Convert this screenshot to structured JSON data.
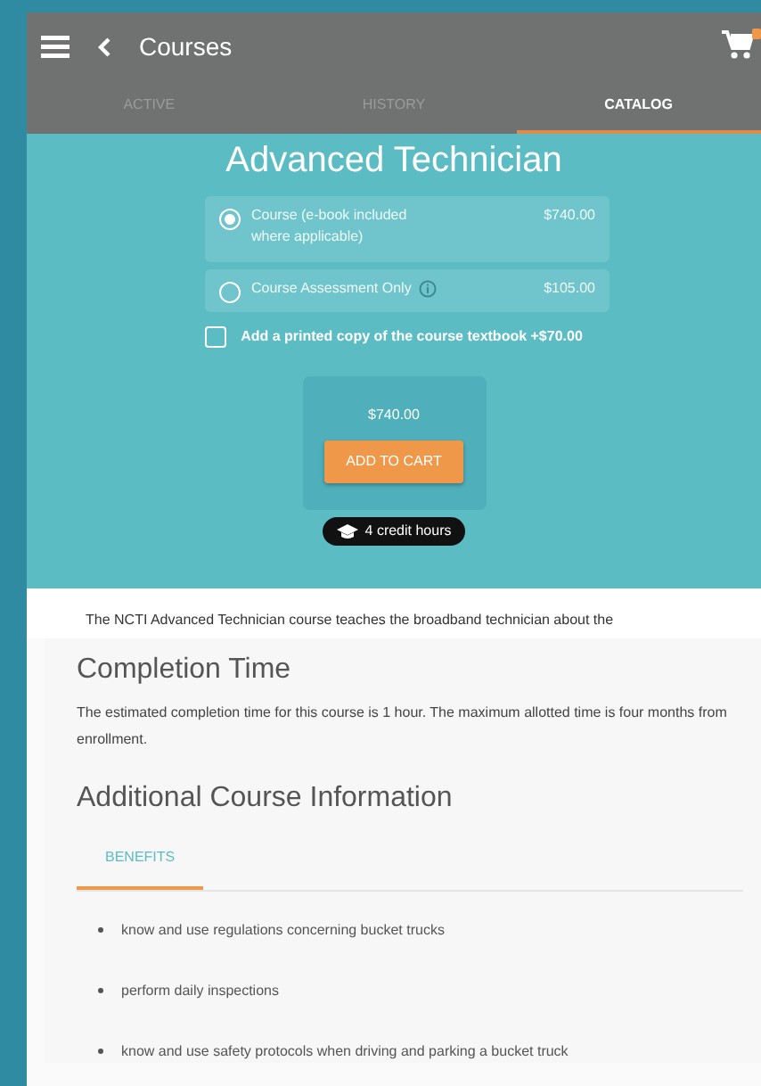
{
  "header": {
    "title": "Courses"
  },
  "tabs": [
    {
      "label": "ACTIVE",
      "selected": false
    },
    {
      "label": "HISTORY",
      "selected": false
    },
    {
      "label": "CATALOG",
      "selected": true
    }
  ],
  "course": {
    "title": "Advanced Technician",
    "options": [
      {
        "label": "Course (e-book included where applicable)",
        "price": "$740.00",
        "selected": true,
        "info": false
      },
      {
        "label": "Course Assessment Only",
        "price": "$105.00",
        "selected": false,
        "info": true
      }
    ],
    "addon": {
      "label": "Add a printed copy of the course textbook +$70.00",
      "checked": false
    },
    "total": "$740.00",
    "add_to_cart": "ADD TO CART",
    "credit_hours": "4 credit hours"
  },
  "description": "The NCTI Advanced Technician course teaches the broadband technician about the",
  "completion": {
    "heading": "Completion Time",
    "text": "The estimated completion time for this course is 1 hour. The maximum allotted time is four months from enrollment."
  },
  "additional": {
    "heading": "Additional Course Information",
    "tabs": [
      {
        "label": "BENEFITS",
        "selected": true
      }
    ],
    "benefits": [
      "know and use regulations concerning bucket trucks",
      "perform daily inspections",
      "know and use safety protocols when driving and parking a bucket truck"
    ]
  }
}
